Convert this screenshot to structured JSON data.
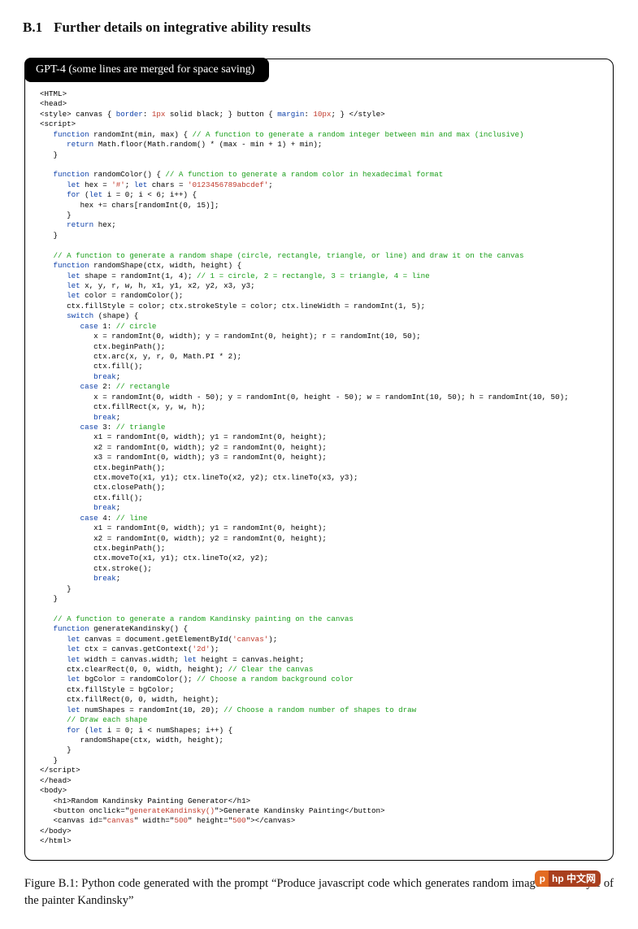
{
  "heading": {
    "num": "B.1",
    "title": "Further details on integrative ability results"
  },
  "tab_label": "GPT-4 (some lines are merged for space saving)",
  "caption": "Figure B.1:  Python code generated with the prompt “Produce javascript code which generates random images in the style of the painter Kandinsky”",
  "watermark": {
    "left": "p",
    "right": "hp 中文网"
  },
  "code": [
    {
      "i": 0,
      "t": [
        {
          "c": "n",
          "v": "<HTML>"
        }
      ]
    },
    {
      "i": 0,
      "t": [
        {
          "c": "n",
          "v": "<head>"
        }
      ]
    },
    {
      "i": 0,
      "t": [
        {
          "c": "n",
          "v": "<style> canvas { "
        },
        {
          "c": "k",
          "v": "border"
        },
        {
          "c": "n",
          "v": ": "
        },
        {
          "c": "nm",
          "v": "1px"
        },
        {
          "c": "n",
          "v": " solid black; } button { "
        },
        {
          "c": "k",
          "v": "margin"
        },
        {
          "c": "n",
          "v": ": "
        },
        {
          "c": "nm",
          "v": "10px"
        },
        {
          "c": "n",
          "v": "; } </style>"
        }
      ]
    },
    {
      "i": 0,
      "t": [
        {
          "c": "n",
          "v": "<script>"
        }
      ]
    },
    {
      "i": 1,
      "t": [
        {
          "c": "k",
          "v": "function"
        },
        {
          "c": "n",
          "v": " randomInt(min, max) { "
        },
        {
          "c": "c",
          "v": "// A function to generate a random integer between min and max (inclusive)"
        }
      ]
    },
    {
      "i": 2,
      "t": [
        {
          "c": "k",
          "v": "return"
        },
        {
          "c": "n",
          "v": " Math.floor(Math.random() * (max - min + 1) + min);"
        }
      ]
    },
    {
      "i": 1,
      "t": [
        {
          "c": "n",
          "v": "}"
        }
      ]
    },
    {
      "i": 0,
      "t": [
        {
          "c": "n",
          "v": ""
        }
      ]
    },
    {
      "i": 1,
      "t": [
        {
          "c": "k",
          "v": "function"
        },
        {
          "c": "n",
          "v": " randomColor() { "
        },
        {
          "c": "c",
          "v": "// A function to generate a random color in hexadecimal format"
        }
      ]
    },
    {
      "i": 2,
      "t": [
        {
          "c": "k",
          "v": "let"
        },
        {
          "c": "n",
          "v": " hex = "
        },
        {
          "c": "s",
          "v": "'#'"
        },
        {
          "c": "n",
          "v": "; "
        },
        {
          "c": "k",
          "v": "let"
        },
        {
          "c": "n",
          "v": " chars = "
        },
        {
          "c": "s",
          "v": "'0123456789abcdef'"
        },
        {
          "c": "n",
          "v": ";"
        }
      ]
    },
    {
      "i": 2,
      "t": [
        {
          "c": "k",
          "v": "for"
        },
        {
          "c": "n",
          "v": " ("
        },
        {
          "c": "k",
          "v": "let"
        },
        {
          "c": "n",
          "v": " i = 0; i < 6; i++) {"
        }
      ]
    },
    {
      "i": 3,
      "t": [
        {
          "c": "n",
          "v": "hex += chars[randomInt(0, 15)];"
        }
      ]
    },
    {
      "i": 2,
      "t": [
        {
          "c": "n",
          "v": "}"
        }
      ]
    },
    {
      "i": 2,
      "t": [
        {
          "c": "k",
          "v": "return"
        },
        {
          "c": "n",
          "v": " hex;"
        }
      ]
    },
    {
      "i": 1,
      "t": [
        {
          "c": "n",
          "v": "}"
        }
      ]
    },
    {
      "i": 0,
      "t": [
        {
          "c": "n",
          "v": ""
        }
      ]
    },
    {
      "i": 1,
      "t": [
        {
          "c": "c",
          "v": "// A function to generate a random shape (circle, rectangle, triangle, or line) and draw it on the canvas"
        }
      ]
    },
    {
      "i": 1,
      "t": [
        {
          "c": "k",
          "v": "function"
        },
        {
          "c": "n",
          "v": " randomShape(ctx, width, height) {"
        }
      ]
    },
    {
      "i": 2,
      "t": [
        {
          "c": "k",
          "v": "let"
        },
        {
          "c": "n",
          "v": " shape = randomInt(1, 4); "
        },
        {
          "c": "c",
          "v": "// 1 = circle, 2 = rectangle, 3 = triangle, 4 = line"
        }
      ]
    },
    {
      "i": 2,
      "t": [
        {
          "c": "k",
          "v": "let"
        },
        {
          "c": "n",
          "v": " x, y, r, w, h, x1, y1, x2, y2, x3, y3;"
        }
      ]
    },
    {
      "i": 2,
      "t": [
        {
          "c": "k",
          "v": "let"
        },
        {
          "c": "n",
          "v": " color = randomColor();"
        }
      ]
    },
    {
      "i": 2,
      "t": [
        {
          "c": "n",
          "v": "ctx.fillStyle = color; ctx.strokeStyle = color; ctx.lineWidth = randomInt(1, 5);"
        }
      ]
    },
    {
      "i": 2,
      "t": [
        {
          "c": "k",
          "v": "switch"
        },
        {
          "c": "n",
          "v": " (shape) {"
        }
      ]
    },
    {
      "i": 3,
      "t": [
        {
          "c": "k",
          "v": "case"
        },
        {
          "c": "n",
          "v": " 1: "
        },
        {
          "c": "c",
          "v": "// circle"
        }
      ]
    },
    {
      "i": 4,
      "t": [
        {
          "c": "n",
          "v": "x = randomInt(0, width); y = randomInt(0, height); r = randomInt(10, 50);"
        }
      ]
    },
    {
      "i": 4,
      "t": [
        {
          "c": "n",
          "v": "ctx.beginPath();"
        }
      ]
    },
    {
      "i": 4,
      "t": [
        {
          "c": "n",
          "v": "ctx.arc(x, y, r, 0, Math.PI * 2);"
        }
      ]
    },
    {
      "i": 4,
      "t": [
        {
          "c": "n",
          "v": "ctx.fill();"
        }
      ]
    },
    {
      "i": 4,
      "t": [
        {
          "c": "k",
          "v": "break"
        },
        {
          "c": "n",
          "v": ";"
        }
      ]
    },
    {
      "i": 3,
      "t": [
        {
          "c": "k",
          "v": "case"
        },
        {
          "c": "n",
          "v": " 2: "
        },
        {
          "c": "c",
          "v": "// rectangle"
        }
      ]
    },
    {
      "i": 4,
      "t": [
        {
          "c": "n",
          "v": "x = randomInt(0, width - 50); y = randomInt(0, height - 50); w = randomInt(10, 50); h = randomInt(10, 50);"
        }
      ]
    },
    {
      "i": 4,
      "t": [
        {
          "c": "n",
          "v": "ctx.fillRect(x, y, w, h);"
        }
      ]
    },
    {
      "i": 4,
      "t": [
        {
          "c": "k",
          "v": "break"
        },
        {
          "c": "n",
          "v": ";"
        }
      ]
    },
    {
      "i": 3,
      "t": [
        {
          "c": "k",
          "v": "case"
        },
        {
          "c": "n",
          "v": " 3: "
        },
        {
          "c": "c",
          "v": "// triangle"
        }
      ]
    },
    {
      "i": 4,
      "t": [
        {
          "c": "n",
          "v": "x1 = randomInt(0, width); y1 = randomInt(0, height);"
        }
      ]
    },
    {
      "i": 4,
      "t": [
        {
          "c": "n",
          "v": "x2 = randomInt(0, width); y2 = randomInt(0, height);"
        }
      ]
    },
    {
      "i": 4,
      "t": [
        {
          "c": "n",
          "v": "x3 = randomInt(0, width); y3 = randomInt(0, height);"
        }
      ]
    },
    {
      "i": 4,
      "t": [
        {
          "c": "n",
          "v": "ctx.beginPath();"
        }
      ]
    },
    {
      "i": 4,
      "t": [
        {
          "c": "n",
          "v": "ctx.moveTo(x1, y1); ctx.lineTo(x2, y2); ctx.lineTo(x3, y3);"
        }
      ]
    },
    {
      "i": 4,
      "t": [
        {
          "c": "n",
          "v": "ctx.closePath();"
        }
      ]
    },
    {
      "i": 4,
      "t": [
        {
          "c": "n",
          "v": "ctx.fill();"
        }
      ]
    },
    {
      "i": 4,
      "t": [
        {
          "c": "k",
          "v": "break"
        },
        {
          "c": "n",
          "v": ";"
        }
      ]
    },
    {
      "i": 3,
      "t": [
        {
          "c": "k",
          "v": "case"
        },
        {
          "c": "n",
          "v": " 4: "
        },
        {
          "c": "c",
          "v": "// line"
        }
      ]
    },
    {
      "i": 4,
      "t": [
        {
          "c": "n",
          "v": "x1 = randomInt(0, width); y1 = randomInt(0, height);"
        }
      ]
    },
    {
      "i": 4,
      "t": [
        {
          "c": "n",
          "v": "x2 = randomInt(0, width); y2 = randomInt(0, height);"
        }
      ]
    },
    {
      "i": 4,
      "t": [
        {
          "c": "n",
          "v": "ctx.beginPath();"
        }
      ]
    },
    {
      "i": 4,
      "t": [
        {
          "c": "n",
          "v": "ctx.moveTo(x1, y1); ctx.lineTo(x2, y2);"
        }
      ]
    },
    {
      "i": 4,
      "t": [
        {
          "c": "n",
          "v": "ctx.stroke();"
        }
      ]
    },
    {
      "i": 4,
      "t": [
        {
          "c": "k",
          "v": "break"
        },
        {
          "c": "n",
          "v": ";"
        }
      ]
    },
    {
      "i": 2,
      "t": [
        {
          "c": "n",
          "v": "}"
        }
      ]
    },
    {
      "i": 1,
      "t": [
        {
          "c": "n",
          "v": "}"
        }
      ]
    },
    {
      "i": 0,
      "t": [
        {
          "c": "n",
          "v": ""
        }
      ]
    },
    {
      "i": 1,
      "t": [
        {
          "c": "c",
          "v": "// A function to generate a random Kandinsky painting on the canvas"
        }
      ]
    },
    {
      "i": 1,
      "t": [
        {
          "c": "k",
          "v": "function"
        },
        {
          "c": "n",
          "v": " generateKandinsky() {"
        }
      ]
    },
    {
      "i": 2,
      "t": [
        {
          "c": "k",
          "v": "let"
        },
        {
          "c": "n",
          "v": " canvas = document.getElementById("
        },
        {
          "c": "s",
          "v": "'canvas'"
        },
        {
          "c": "n",
          "v": ");"
        }
      ]
    },
    {
      "i": 2,
      "t": [
        {
          "c": "k",
          "v": "let"
        },
        {
          "c": "n",
          "v": " ctx = canvas.getContext("
        },
        {
          "c": "s",
          "v": "'2d'"
        },
        {
          "c": "n",
          "v": ");"
        }
      ]
    },
    {
      "i": 2,
      "t": [
        {
          "c": "k",
          "v": "let"
        },
        {
          "c": "n",
          "v": " width = canvas.width; "
        },
        {
          "c": "k",
          "v": "let"
        },
        {
          "c": "n",
          "v": " height = canvas.height;"
        }
      ]
    },
    {
      "i": 2,
      "t": [
        {
          "c": "n",
          "v": "ctx.clearRect(0, 0, width, height); "
        },
        {
          "c": "c",
          "v": "// Clear the canvas"
        }
      ]
    },
    {
      "i": 2,
      "t": [
        {
          "c": "k",
          "v": "let"
        },
        {
          "c": "n",
          "v": " bgColor = randomColor(); "
        },
        {
          "c": "c",
          "v": "// Choose a random background color"
        }
      ]
    },
    {
      "i": 2,
      "t": [
        {
          "c": "n",
          "v": "ctx.fillStyle = bgColor;"
        }
      ]
    },
    {
      "i": 2,
      "t": [
        {
          "c": "n",
          "v": "ctx.fillRect(0, 0, width, height);"
        }
      ]
    },
    {
      "i": 2,
      "t": [
        {
          "c": "k",
          "v": "let"
        },
        {
          "c": "n",
          "v": " numShapes = randomInt(10, 20); "
        },
        {
          "c": "c",
          "v": "// Choose a random number of shapes to draw"
        }
      ]
    },
    {
      "i": 2,
      "t": [
        {
          "c": "c",
          "v": "// Draw each shape"
        }
      ]
    },
    {
      "i": 2,
      "t": [
        {
          "c": "k",
          "v": "for"
        },
        {
          "c": "n",
          "v": " ("
        },
        {
          "c": "k",
          "v": "let"
        },
        {
          "c": "n",
          "v": " i = 0; i < numShapes; i++) {"
        }
      ]
    },
    {
      "i": 3,
      "t": [
        {
          "c": "n",
          "v": "randomShape(ctx, width, height);"
        }
      ]
    },
    {
      "i": 2,
      "t": [
        {
          "c": "n",
          "v": "}"
        }
      ]
    },
    {
      "i": 1,
      "t": [
        {
          "c": "n",
          "v": "}"
        }
      ]
    },
    {
      "i": 0,
      "t": [
        {
          "c": "n",
          "v": "</script>"
        }
      ]
    },
    {
      "i": 0,
      "t": [
        {
          "c": "n",
          "v": "</head>"
        }
      ]
    },
    {
      "i": 0,
      "t": [
        {
          "c": "n",
          "v": "<body>"
        }
      ]
    },
    {
      "i": 1,
      "t": [
        {
          "c": "n",
          "v": "<h1>Random Kandinsky Painting Generator</h1>"
        }
      ]
    },
    {
      "i": 1,
      "t": [
        {
          "c": "n",
          "v": "<button onclick=\""
        },
        {
          "c": "nm",
          "v": "generateKandinsky()"
        },
        {
          "c": "n",
          "v": "\">Generate Kandinsky Painting</button>"
        }
      ]
    },
    {
      "i": 1,
      "t": [
        {
          "c": "n",
          "v": "<canvas id=\""
        },
        {
          "c": "nm",
          "v": "canvas"
        },
        {
          "c": "n",
          "v": "\" width=\""
        },
        {
          "c": "nm",
          "v": "500"
        },
        {
          "c": "n",
          "v": "\" height=\""
        },
        {
          "c": "nm",
          "v": "500"
        },
        {
          "c": "n",
          "v": "\"></canvas>"
        }
      ]
    },
    {
      "i": 0,
      "t": [
        {
          "c": "n",
          "v": "</body>"
        }
      ]
    },
    {
      "i": 0,
      "t": [
        {
          "c": "n",
          "v": "</html>"
        }
      ]
    }
  ]
}
